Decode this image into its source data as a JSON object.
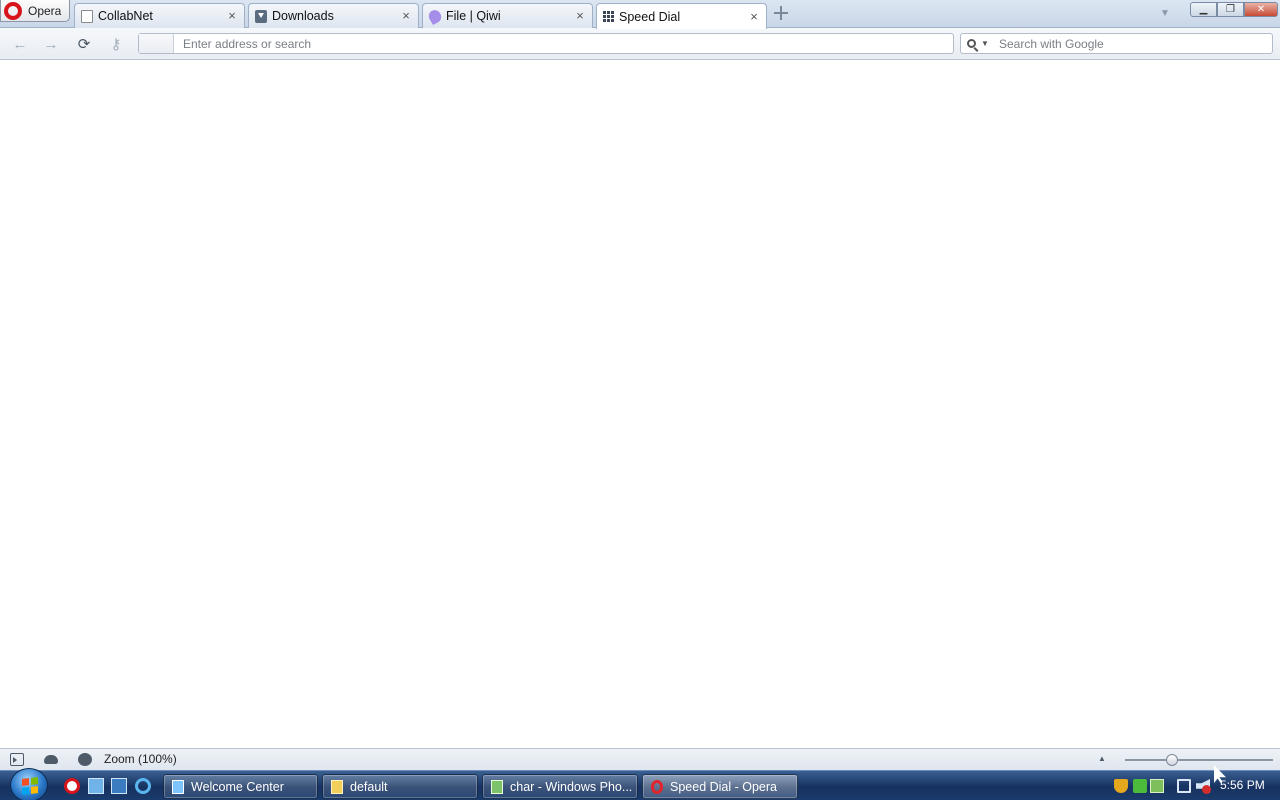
{
  "browser": {
    "menu_label": "Opera",
    "tabs": [
      {
        "label": "CollabNet",
        "icon": "document-icon",
        "active": false
      },
      {
        "label": "Downloads",
        "icon": "download-icon",
        "active": false
      },
      {
        "label": "File | Qiwi",
        "icon": "qiwi-icon",
        "active": false
      },
      {
        "label": "Speed Dial",
        "icon": "speed-dial-grid-icon",
        "active": true
      }
    ],
    "tab_close_glyph": "×",
    "address_placeholder": "Enter address or search",
    "address_value": "",
    "search_placeholder": "Search with Google",
    "search_value": ""
  },
  "statusbar": {
    "zoom_label": "Zoom (100%)",
    "zoom_percent": 100,
    "zoom_slider_level": 0.3
  },
  "taskbar": {
    "windows": [
      {
        "label": "Welcome Center",
        "icon": "welcome-center-icon",
        "active": false
      },
      {
        "label": "default",
        "icon": "folder-icon",
        "active": false
      },
      {
        "label": "char - Windows Pho...",
        "icon": "photo-viewer-icon",
        "active": false
      },
      {
        "label": "Speed Dial - Opera",
        "icon": "opera-icon",
        "active": true
      }
    ],
    "clock": "5:56 PM"
  },
  "colors": {
    "opera_red": "#d8151b",
    "taskbar_blue": "#16325f",
    "chrome_blue": "#dce6f2"
  }
}
